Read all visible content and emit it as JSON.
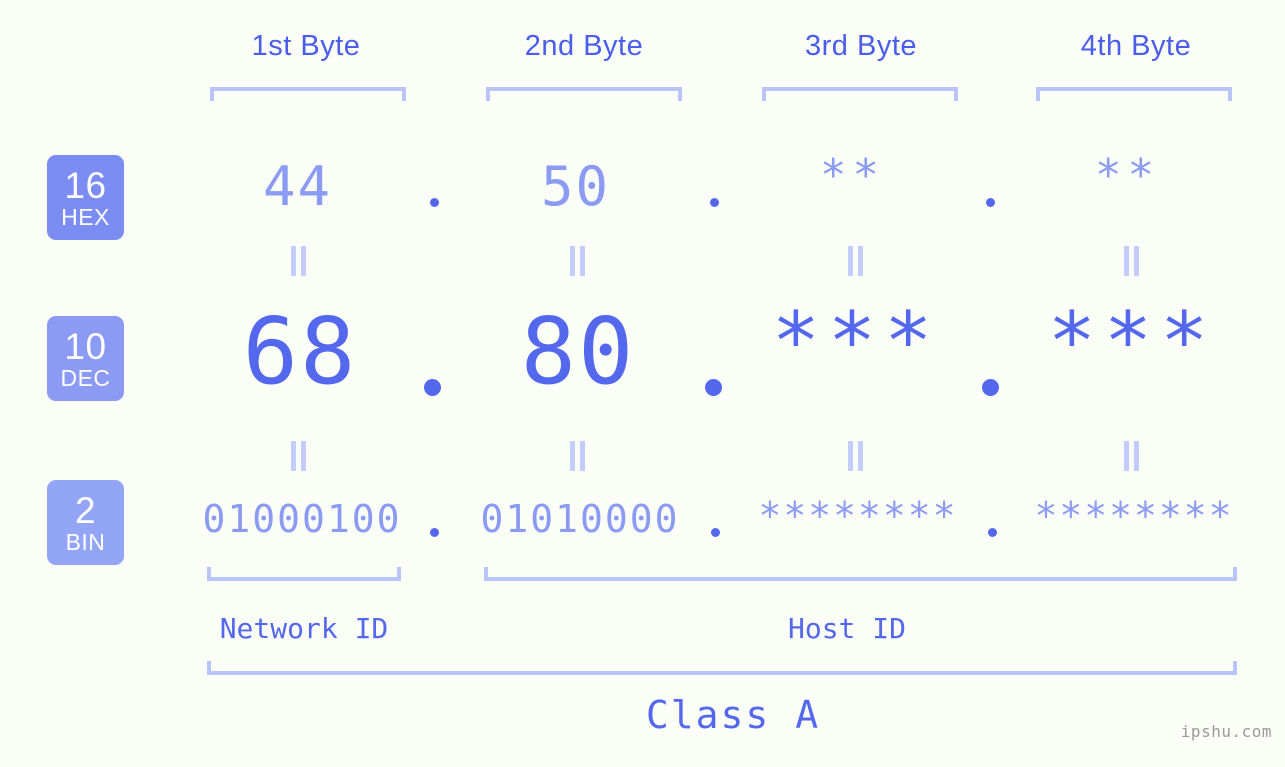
{
  "background_color": "#fbfdf7",
  "accent_colors": {
    "primary": "#5468ee",
    "secondary": "#8b9bf4",
    "bracket": "#b9c4f9",
    "badge_hex": "#7b8cf2",
    "badge_dec": "#8b9bf4",
    "badge_bin": "#93a5f7",
    "watermark": "#9a9a9a"
  },
  "byte_headers": [
    {
      "label": "1st Byte"
    },
    {
      "label": "2nd Byte"
    },
    {
      "label": "3rd Byte"
    },
    {
      "label": "4th Byte"
    }
  ],
  "rows": [
    {
      "badge_number": "16",
      "badge_unit": "HEX",
      "values": [
        "44",
        "50",
        "**",
        "**"
      ]
    },
    {
      "badge_number": "10",
      "badge_unit": "DEC",
      "values": [
        "68",
        "80",
        "***",
        "***"
      ]
    },
    {
      "badge_number": "2",
      "badge_unit": "BIN",
      "values": [
        "01000100",
        "01010000",
        "********",
        "********"
      ]
    }
  ],
  "separators": [
    ".",
    ".",
    "."
  ],
  "id_sections": [
    {
      "label": "Network ID"
    },
    {
      "label": "Host ID"
    }
  ],
  "class_label": "Class A",
  "watermark": "ipshu.com"
}
